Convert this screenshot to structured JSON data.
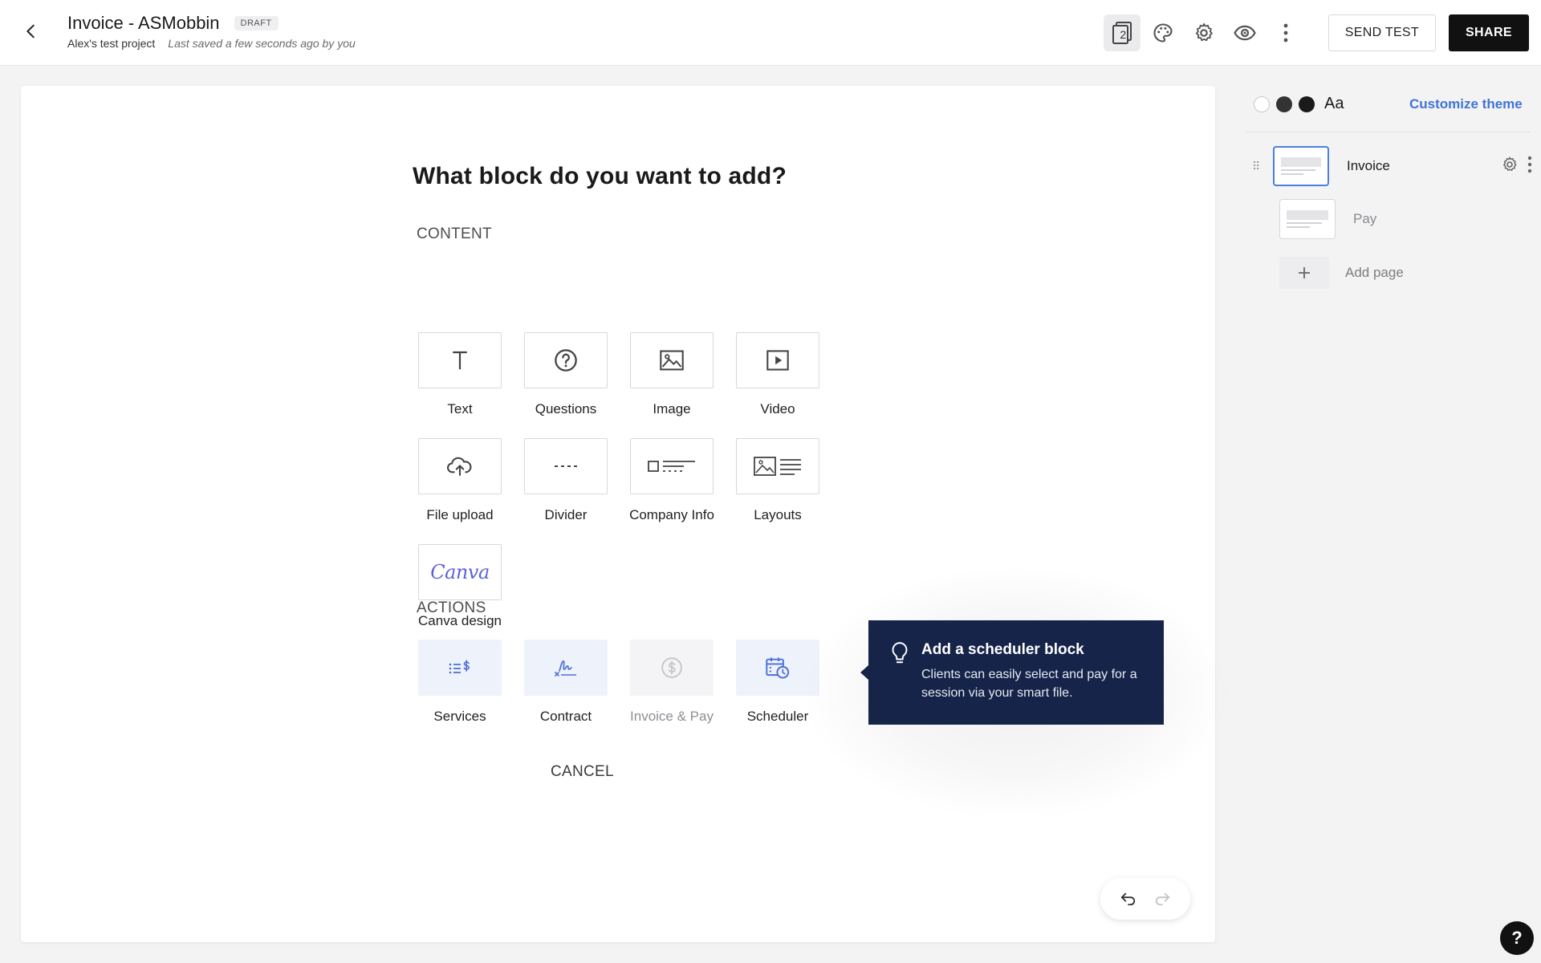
{
  "header": {
    "title": "Invoice - ASMobbin",
    "badge": "DRAFT",
    "project": "Alex's test project",
    "saved": "Last saved a few seconds ago by you",
    "pages_count": "2",
    "send_test_label": "SEND TEST",
    "share_label": "SHARE"
  },
  "picker": {
    "title": "What block do you want to add?",
    "content_label": "CONTENT",
    "actions_label": "ACTIONS",
    "content_blocks": [
      {
        "label": "Text",
        "icon": "text-icon"
      },
      {
        "label": "Questions",
        "icon": "question-circle-icon"
      },
      {
        "label": "Image",
        "icon": "image-icon"
      },
      {
        "label": "Video",
        "icon": "video-play-icon"
      },
      {
        "label": "File upload",
        "icon": "cloud-upload-icon"
      },
      {
        "label": "Divider",
        "icon": "divider-icon"
      },
      {
        "label": "Company Info",
        "icon": "company-info-icon"
      },
      {
        "label": "Layouts",
        "icon": "layouts-icon"
      },
      {
        "label": "Canva design",
        "icon": "canva-logo",
        "logo_text": "Canva"
      }
    ],
    "action_blocks": [
      {
        "label": "Services",
        "icon": "services-list-dollar-icon"
      },
      {
        "label": "Contract",
        "icon": "signature-icon"
      },
      {
        "label": "Invoice & Pay",
        "icon": "dollar-circle-icon",
        "disabled": true
      },
      {
        "label": "Scheduler",
        "icon": "calendar-clock-icon"
      }
    ],
    "cancel_label": "CANCEL"
  },
  "tooltip": {
    "title": "Add a scheduler block",
    "body": "Clients can easily select and pay for a session via your smart file.",
    "icon": "lightbulb-icon"
  },
  "theme": {
    "swatches": [
      "#ffffff",
      "#333333",
      "#1a1a1a"
    ],
    "font_sample": "Aa",
    "customize_label": "Customize theme",
    "accent": "#3f74d6"
  },
  "pages": {
    "items": [
      {
        "name": "Invoice",
        "selected": true
      },
      {
        "name": "Pay",
        "selected": false
      }
    ],
    "add_label": "Add page"
  },
  "help_label": "?"
}
